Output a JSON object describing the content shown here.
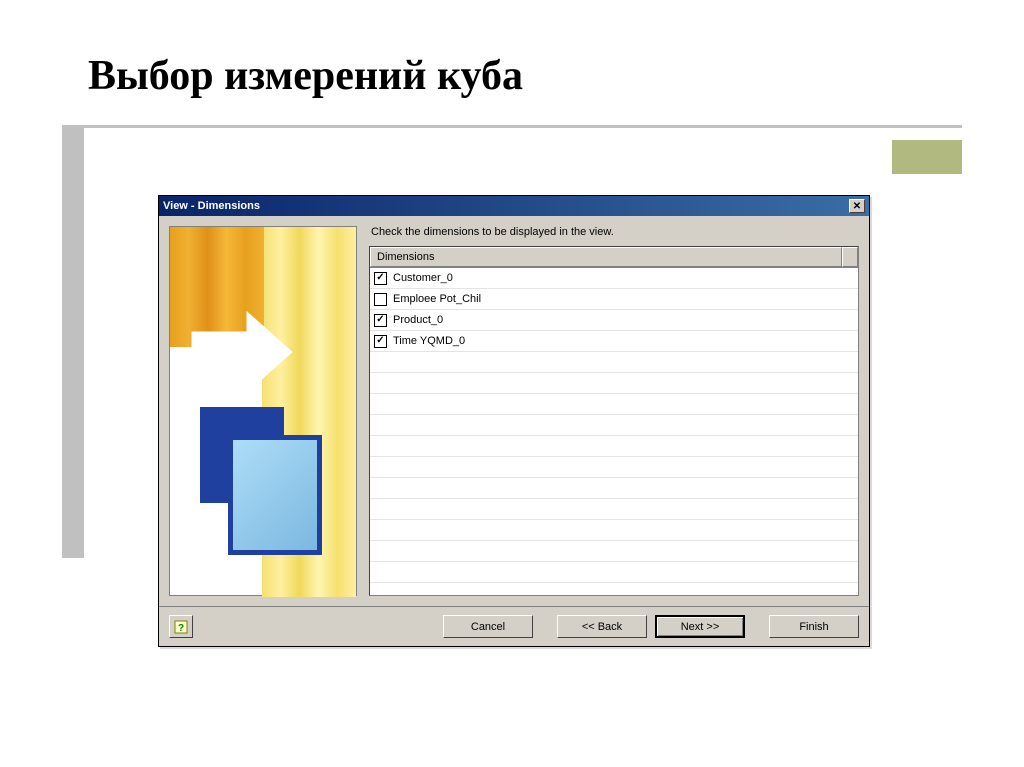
{
  "slide": {
    "title": "Выбор измерений куба"
  },
  "dialog": {
    "title": "View - Dimensions",
    "instruction": "Check the dimensions to be displayed in the view.",
    "columnHeader": "Dimensions",
    "items": [
      {
        "label": "Customer_0",
        "checked": true
      },
      {
        "label": "Emploee Pot_Chil",
        "checked": false
      },
      {
        "label": "Product_0",
        "checked": true
      },
      {
        "label": "Time YQMD_0",
        "checked": true
      }
    ],
    "buttons": {
      "cancel": "Cancel",
      "back": "<< Back",
      "next": "Next >>",
      "finish": "Finish"
    }
  }
}
